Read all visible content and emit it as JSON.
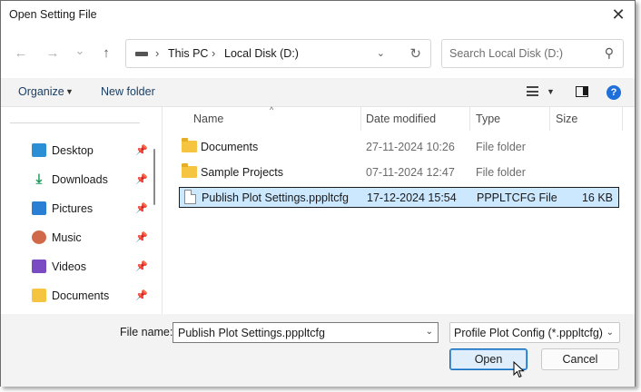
{
  "window": {
    "title": "Open Setting File",
    "close_glyph": "✕"
  },
  "nav": {
    "back_glyph": "←",
    "forward_glyph": "→",
    "recent_glyph": "⌄",
    "up_glyph": "↑"
  },
  "address": {
    "crumbs": [
      "This PC",
      "Local Disk (D:)"
    ],
    "separator": "›",
    "chevron": "⌄",
    "refresh_glyph": "↻"
  },
  "search": {
    "placeholder": "Search Local Disk (D:)",
    "icon_glyph": "⚲"
  },
  "toolbar": {
    "organize_label": "Organize",
    "organize_caret": "▼",
    "new_folder_label": "New folder",
    "view_caret": "▼",
    "help_glyph": "?"
  },
  "sidebar": {
    "pin_glyph": "📌",
    "items": [
      {
        "label": "Desktop",
        "icon": "desktop-icon",
        "color": "#2b8fd6"
      },
      {
        "label": "Downloads",
        "icon": "download-icon",
        "color": "#1b9a5a"
      },
      {
        "label": "Pictures",
        "icon": "pictures-icon",
        "color": "#2a7fd4"
      },
      {
        "label": "Music",
        "icon": "music-icon",
        "color": "#d0684a"
      },
      {
        "label": "Videos",
        "icon": "videos-icon",
        "color": "#7b4bc4"
      },
      {
        "label": "Documents",
        "icon": "folder-icon",
        "color": "#f5c542"
      }
    ]
  },
  "file_list": {
    "columns": [
      "Name",
      "Date modified",
      "Type",
      "Size"
    ],
    "sort_glyph": "^",
    "rows": [
      {
        "name": "Documents",
        "date": "27-11-2024 10:26",
        "type": "File folder",
        "size": "",
        "icon": "folder-icon",
        "selected": false
      },
      {
        "name": "Sample Projects",
        "date": "07-11-2024 12:47",
        "type": "File folder",
        "size": "",
        "icon": "folder-icon",
        "selected": false
      },
      {
        "name": "Publish Plot Settings.pppltcfg",
        "date": "17-12-2024 15:54",
        "type": "PPPLTCFG File",
        "size": "16 KB",
        "icon": "file-icon",
        "selected": true
      }
    ]
  },
  "footer": {
    "file_name_label": "File name:",
    "file_name_value": "Publish Plot Settings.pppltcfg",
    "file_type_value": "Profile Plot Config (*.pppltcfg)",
    "caret": "⌄",
    "open_label": "Open",
    "cancel_label": "Cancel"
  },
  "colors": {
    "accent": "#0f6cbd",
    "selection": "#cce8ff",
    "folder": "#f5c542"
  }
}
